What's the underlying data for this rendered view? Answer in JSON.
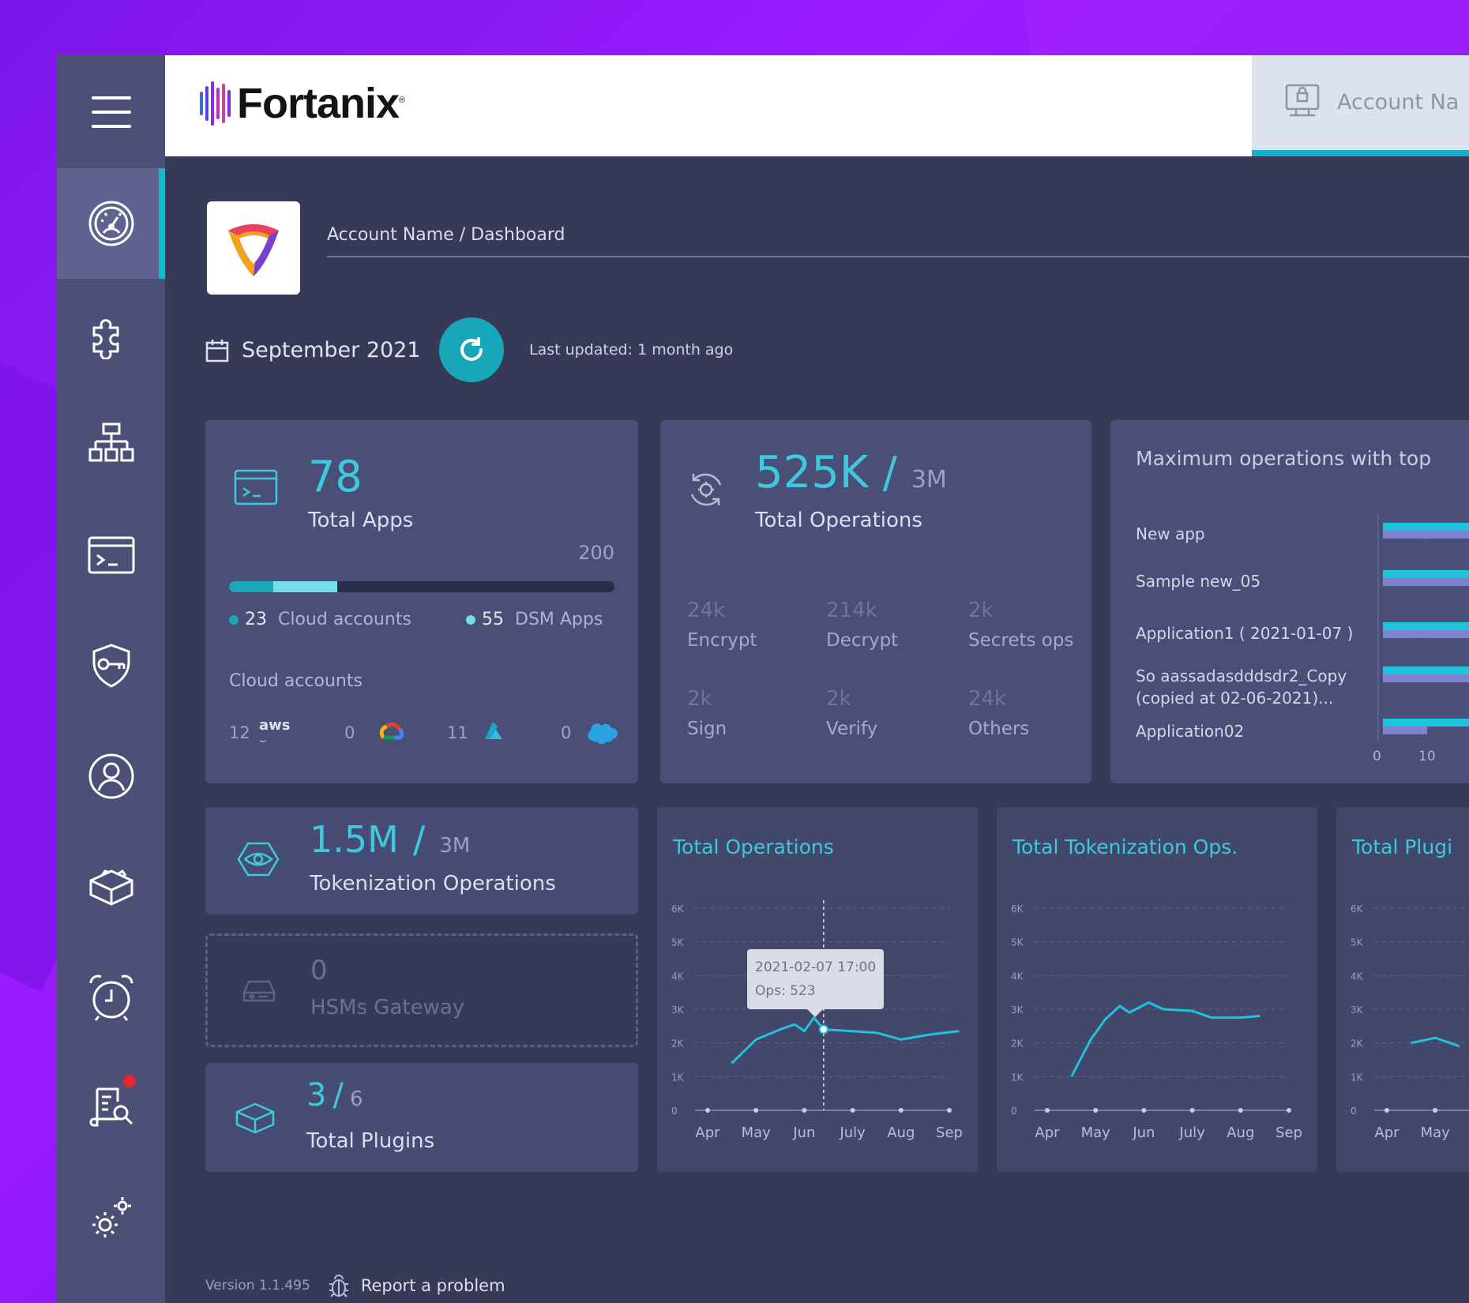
{
  "brand": {
    "name": "Fortanix",
    "registered": "®"
  },
  "header": {
    "account_label": "Account Na"
  },
  "breadcrumb": "Account Name / Dashboard",
  "date_label": "September 2021",
  "last_updated": "Last updated: 1 month ago",
  "sidebar": {
    "items": [
      {
        "icon": "dashboard-gauge-icon"
      },
      {
        "icon": "puzzle-icon"
      },
      {
        "icon": "hierarchy-icon"
      },
      {
        "icon": "terminal-icon"
      },
      {
        "icon": "security-key-icon"
      },
      {
        "icon": "user-icon"
      },
      {
        "icon": "plugins-icon"
      },
      {
        "icon": "alarm-clock-icon"
      },
      {
        "icon": "audit-log-icon",
        "has_notification": true
      },
      {
        "icon": "settings-icon"
      }
    ]
  },
  "apps_card": {
    "count": "78",
    "label": "Total Apps",
    "limit": "200",
    "limit_value": 200,
    "cloud_count": "23",
    "cloud_label": "Cloud accounts",
    "dsm_count": "55",
    "dsm_label": "DSM Apps",
    "cloud_section_title": "Cloud accounts",
    "providers": [
      {
        "count": "12",
        "name": "aws"
      },
      {
        "count": "0",
        "name": "google-cloud"
      },
      {
        "count": "11",
        "name": "azure"
      },
      {
        "count": "0",
        "name": "salesforce"
      }
    ]
  },
  "ops_card": {
    "value": "525K",
    "separator": "/",
    "limit": "3M",
    "label": "Total Operations",
    "stats": [
      {
        "value": "24k",
        "label": "Encrypt"
      },
      {
        "value": "214k",
        "label": "Decrypt"
      },
      {
        "value": "2k",
        "label": "Secrets ops"
      },
      {
        "value": "2k",
        "label": "Sign"
      },
      {
        "value": "2k",
        "label": "Verify"
      },
      {
        "value": "24k",
        "label": "Others"
      }
    ]
  },
  "max_ops_card": {
    "title": "Maximum operations with top",
    "items": [
      {
        "label": "New app"
      },
      {
        "label": "Sample new_05"
      },
      {
        "label": "Application1 ( 2021-01-07 )"
      },
      {
        "label_line1": "So aassadasdddsdr2_Copy",
        "label_line2": "(copied at 02-06-2021)..."
      },
      {
        "label": "Application02"
      }
    ],
    "axis_ticks": [
      "0",
      "10"
    ]
  },
  "token_card": {
    "value": "1.5M",
    "separator": "/",
    "limit": "3M",
    "label": "Tokenization Operations"
  },
  "hsm_card": {
    "value": "0",
    "label": "HSMs Gateway"
  },
  "plugins_card": {
    "value": "3",
    "separator": "/",
    "limit": "6",
    "label": "Total Plugins"
  },
  "footer": {
    "version": "Version 1.1.495",
    "report": "Report a problem"
  },
  "colors": {
    "accent": "#17a7b8",
    "teal_bar": "#1ec3dc",
    "purple_bar": "#7c82d0",
    "bg_purple": "#8a18f2"
  },
  "chart_data": [
    {
      "type": "line",
      "title": "Total Operations",
      "categories": [
        "Apr",
        "May",
        "Jun",
        "July",
        "Aug",
        "Sep"
      ],
      "y_ticks": [
        "0",
        "1K",
        "2K",
        "3K",
        "4K",
        "5K",
        "6K"
      ],
      "ylim": [
        0,
        6000
      ],
      "x": [
        0.5,
        1.0,
        1.5,
        1.8,
        2.0,
        2.2,
        2.4,
        3.0,
        3.5,
        4.0,
        4.6,
        5.2
      ],
      "values": [
        1400,
        2100,
        2400,
        2550,
        2350,
        2750,
        2400,
        2350,
        2300,
        2100,
        2250,
        2350
      ],
      "tooltip": {
        "date": "2021-02-07  17:00",
        "ops": "Ops: 523"
      },
      "tooltip_x": 2.4,
      "tooltip_value": 2400
    },
    {
      "type": "line",
      "title": "Total Tokenization Ops.",
      "categories": [
        "Apr",
        "May",
        "Jun",
        "July",
        "Aug",
        "Sep"
      ],
      "y_ticks": [
        "0",
        "1K",
        "2K",
        "3K",
        "4K",
        "5K",
        "6K"
      ],
      "ylim": [
        0,
        6000
      ],
      "x": [
        0.5,
        0.9,
        1.2,
        1.5,
        1.7,
        2.1,
        2.4,
        3.0,
        3.4,
        4.0,
        4.4
      ],
      "values": [
        1000,
        2100,
        2700,
        3100,
        2900,
        3200,
        3000,
        2950,
        2750,
        2750,
        2800
      ]
    },
    {
      "type": "line",
      "title": "Total Plugi",
      "categories": [
        "Apr",
        "May"
      ],
      "y_ticks": [
        "0",
        "1K",
        "2K",
        "3K",
        "4K",
        "5K",
        "6K"
      ],
      "ylim": [
        0,
        6000
      ],
      "x": [
        0.5,
        1.0,
        1.5
      ],
      "values": [
        2000,
        2150,
        1900
      ]
    }
  ]
}
